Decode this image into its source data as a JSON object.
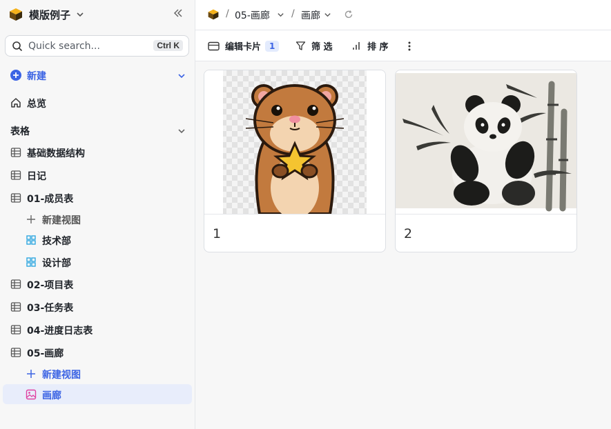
{
  "workspace": {
    "name": "模版例子"
  },
  "search": {
    "placeholder": "Quick search...",
    "shortcut": "Ctrl K"
  },
  "sidebar": {
    "new_label": "新建",
    "overview_label": "总览",
    "tables_section": "表格",
    "items": [
      {
        "label": "基础数据结构"
      },
      {
        "label": "日记"
      },
      {
        "label": "01-成员表"
      },
      {
        "label": "新建视图"
      },
      {
        "label": "技术部"
      },
      {
        "label": "设计部"
      },
      {
        "label": "02-项目表"
      },
      {
        "label": "03-任务表"
      },
      {
        "label": "04-进度日志表"
      },
      {
        "label": "05-画廊"
      },
      {
        "label": "新建视图"
      },
      {
        "label": "画廊"
      }
    ]
  },
  "breadcrumb": {
    "table": "05-画廊",
    "view": "画廊"
  },
  "toolbar": {
    "edit_card": "编辑卡片",
    "edit_card_count": "1",
    "filter": "筛 选",
    "sort": "排 序"
  },
  "cards": [
    {
      "title": "1"
    },
    {
      "title": "2"
    }
  ],
  "colors": {
    "accent": "#3c64e4",
    "selected_bg": "#e8edfb",
    "gallery_icon": "#e040a0",
    "grid_icon": "#2fa7e0"
  }
}
